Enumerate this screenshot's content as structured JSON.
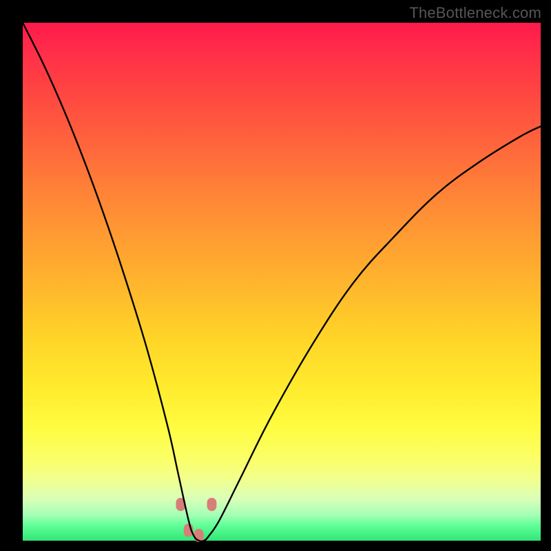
{
  "watermark": "TheBottleneck.com",
  "chart_data": {
    "type": "line",
    "title": "",
    "xlabel": "",
    "ylabel": "",
    "xlim": [
      0,
      100
    ],
    "ylim": [
      0,
      100
    ],
    "grid": false,
    "legend": false,
    "notes": "Unlabeled bottleneck curve plotted over a red-to-green vertical gradient. The curve dips to near 0 around x≈32–35 (the bottleneck sweet spot) and rises toward both edges. Points are approximate, estimated from pixel positions.",
    "series": [
      {
        "name": "bottleneck-curve",
        "x": [
          0,
          4,
          8,
          12,
          16,
          20,
          24,
          28,
          30,
          32,
          33,
          34,
          35,
          36,
          38,
          42,
          48,
          56,
          64,
          72,
          80,
          88,
          96,
          100
        ],
        "values": [
          100,
          92,
          83,
          73,
          62,
          50,
          37,
          22,
          13,
          4,
          1,
          0,
          0,
          1,
          4,
          12,
          24,
          38,
          50,
          59,
          67,
          73,
          78,
          80
        ]
      }
    ],
    "markers": [
      {
        "x": 30.5,
        "y": 7,
        "color": "#d87e79",
        "size": 12
      },
      {
        "x": 32.0,
        "y": 2,
        "color": "#d87e79",
        "size": 12
      },
      {
        "x": 34.0,
        "y": 1,
        "color": "#d87e79",
        "size": 12
      },
      {
        "x": 36.5,
        "y": 7,
        "color": "#d87e79",
        "size": 12
      }
    ],
    "background_gradient": {
      "direction": "top-to-bottom",
      "stops": [
        {
          "pos": 0.0,
          "color": "#ff1a4b"
        },
        {
          "pos": 0.5,
          "color": "#ffb42d"
        },
        {
          "pos": 0.78,
          "color": "#fffc40"
        },
        {
          "pos": 1.0,
          "color": "#30e676"
        }
      ]
    }
  }
}
